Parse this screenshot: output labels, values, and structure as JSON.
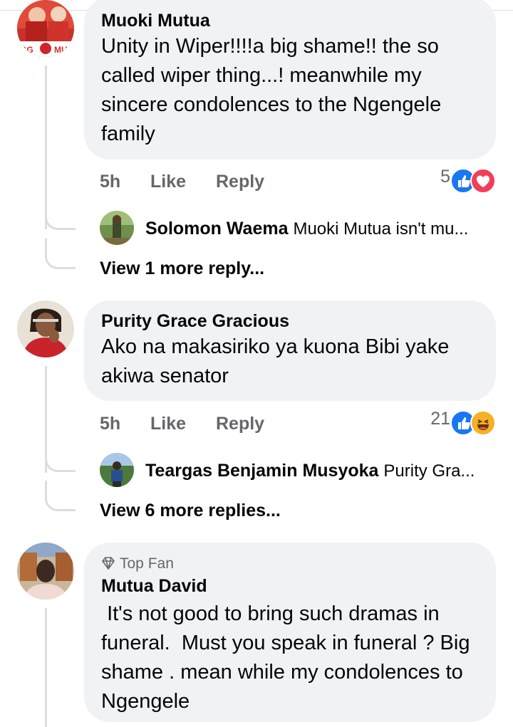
{
  "comments": [
    {
      "author": "Muoki Mutua",
      "text": "Unity in Wiper!!!!a big shame!! the so called wiper thing...! meanwhile my sincere condolences to the Ngengele family",
      "time": "5h",
      "like_label": "Like",
      "reply_label": "Reply",
      "reaction_count": "5",
      "reactions": [
        "like-icon",
        "love-icon"
      ],
      "reply_preview": {
        "author": "Solomon Waema",
        "text": "Muoki Mutua isn't mu..."
      },
      "view_more": "View 1 more reply..."
    },
    {
      "author": "Purity Grace Gracious",
      "text": "Ako na makasiriko ya kuona Bibi yake akiwa senator",
      "time": "5h",
      "like_label": "Like",
      "reply_label": "Reply",
      "reaction_count": "21",
      "reactions": [
        "like-icon",
        "haha-icon"
      ],
      "reply_preview": {
        "author": "Teargas Benjamin Musyoka",
        "text": "Purity Gra..."
      },
      "view_more": "View 6 more replies..."
    },
    {
      "badge": "Top Fan",
      "author": "Mutua David",
      "text": " It's not good to bring such dramas in funeral.  Must you speak in funeral ? Big shame . mean while my condolences to Ngengele"
    }
  ],
  "avatar_badges": {
    "muoki": "MU",
    "muoki_left": "GG"
  },
  "colors": {
    "bubble": "#f0f2f5",
    "meta": "#65676b",
    "like_blue": "#1877f2",
    "love_red": "#f33e58",
    "haha_yellow": "#f7b125"
  }
}
